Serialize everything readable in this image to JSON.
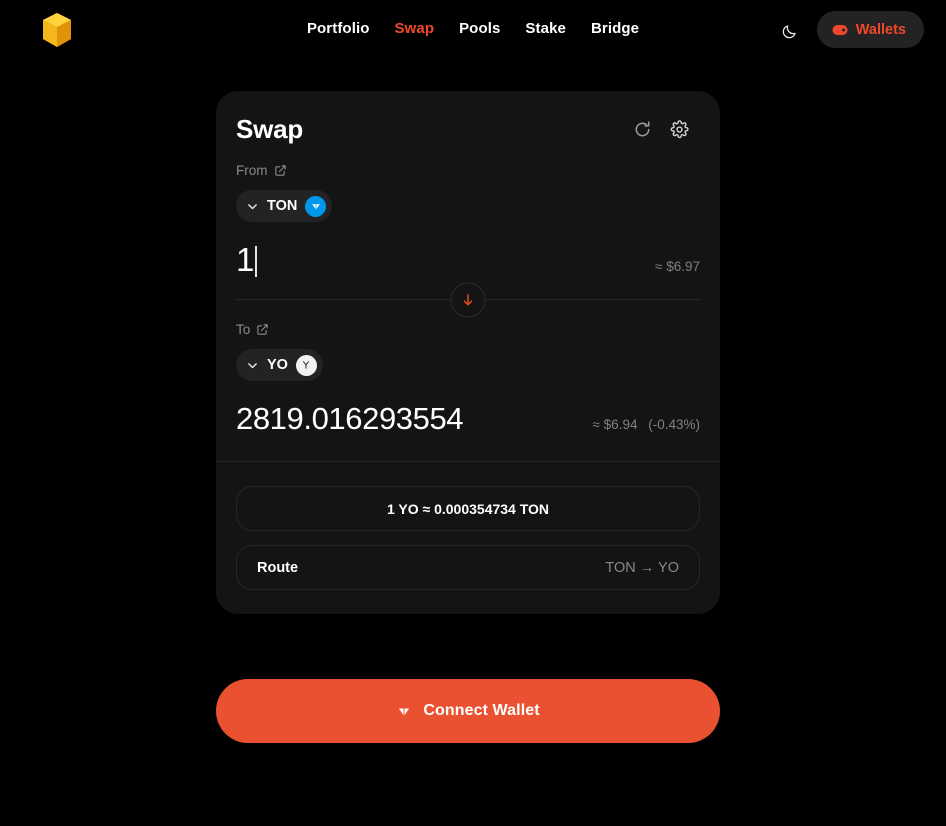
{
  "nav": {
    "logo_icon": "cube-logo-icon",
    "links": [
      {
        "label": "Portfolio",
        "active": false
      },
      {
        "label": "Swap",
        "active": true
      },
      {
        "label": "Pools",
        "active": false
      },
      {
        "label": "Stake",
        "active": false
      },
      {
        "label": "Bridge",
        "active": false
      }
    ],
    "theme_toggle_icon": "moon-icon",
    "wallets_button": {
      "label": "Wallets",
      "icon": "wallet-icon"
    }
  },
  "card": {
    "title": "Swap",
    "refresh_icon": "refresh-icon",
    "settings_icon": "gear-icon",
    "from": {
      "label": "From",
      "external_link_icon": "external-link-icon",
      "token": "TON",
      "token_logo": "ton-diamond-icon",
      "chevron_icon": "chevron-down-icon",
      "amount": "1",
      "usd_value": "≈ $6.97"
    },
    "swap_direction_icon": "arrow-down-icon",
    "to": {
      "label": "To",
      "external_link_icon": "external-link-icon",
      "token": "YO",
      "token_logo": "yo-logo-icon",
      "chevron_icon": "chevron-down-icon",
      "amount": "2819.016293554",
      "usd_value": "≈ $6.94",
      "price_impact": "(-0.43%)"
    },
    "rate": "1 YO ≈ 0.000354734 TON",
    "route": {
      "label": "Route",
      "value": "TON → YO"
    }
  },
  "connect": {
    "label": "Connect Wallet",
    "icon": "ton-diamond-icon"
  },
  "colors": {
    "background": "#000000",
    "card": "#141414",
    "accent": "#f0482a",
    "connect_button": "#ea5130",
    "ton_blue": "#0098ea",
    "muted_text": "#808080"
  }
}
